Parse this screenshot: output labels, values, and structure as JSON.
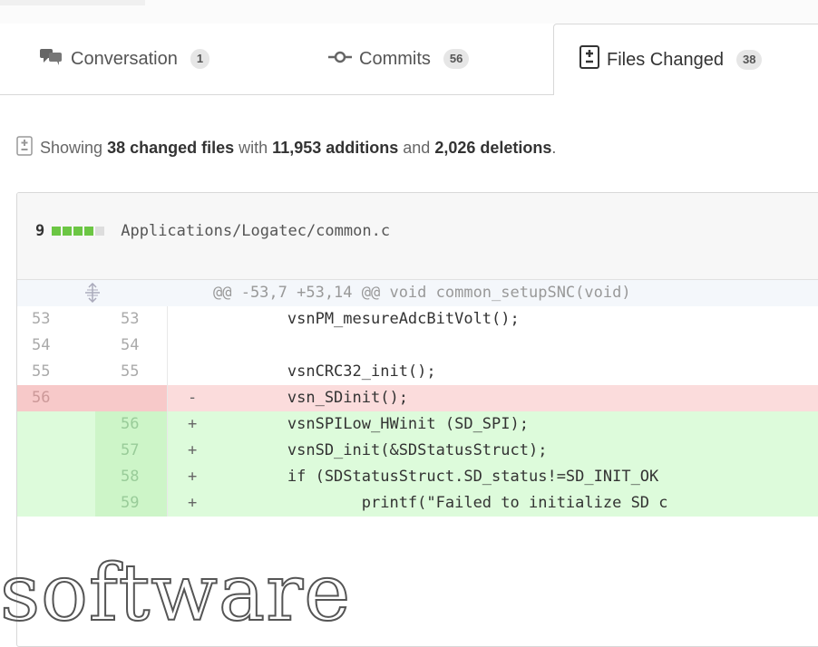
{
  "tabs": [
    {
      "label": "Conversation",
      "count": "1",
      "icon": "comment-discussion-icon"
    },
    {
      "label": "Commits",
      "count": "56",
      "icon": "git-commit-icon"
    },
    {
      "label": "Files Changed",
      "count": "38",
      "icon": "file-diff-icon"
    }
  ],
  "summary": {
    "prefix": "Showing",
    "files": "38 changed files",
    "mid": "with",
    "additions": "11,953 additions",
    "and": "and",
    "deletions": "2,026 deletions",
    "end": "."
  },
  "file": {
    "count": "9",
    "path": "Applications/Logatec/common.c",
    "stat_colors": [
      "#6cc644",
      "#6cc644",
      "#6cc644",
      "#6cc644",
      "#dddddd"
    ]
  },
  "diff": {
    "hunk": "@@ -53,7 +53,14 @@ void common_setupSNC(void)",
    "lines": [
      {
        "old": "53",
        "new": "53",
        "sign": "",
        "code": "        vsnPM_mesureAdcBitVolt();"
      },
      {
        "old": "54",
        "new": "54",
        "sign": "",
        "code": ""
      },
      {
        "old": "55",
        "new": "55",
        "sign": "",
        "code": "        vsnCRC32_init();"
      },
      {
        "old": "56",
        "new": "",
        "sign": "-",
        "code": "        vsn_SDinit();"
      },
      {
        "old": "",
        "new": "56",
        "sign": "+",
        "code": "        vsnSPILow_HWinit (SD_SPI);"
      },
      {
        "old": "",
        "new": "57",
        "sign": "+",
        "code": "        vsnSD_init(&SDStatusStruct);"
      },
      {
        "old": "",
        "new": "58",
        "sign": "+",
        "code": "        if (SDStatusStruct.SD_status!=SD_INIT_OK"
      },
      {
        "old": "",
        "new": "59",
        "sign": "+",
        "code": "                printf(\"Failed to initialize SD c"
      }
    ]
  },
  "watermark": "software"
}
